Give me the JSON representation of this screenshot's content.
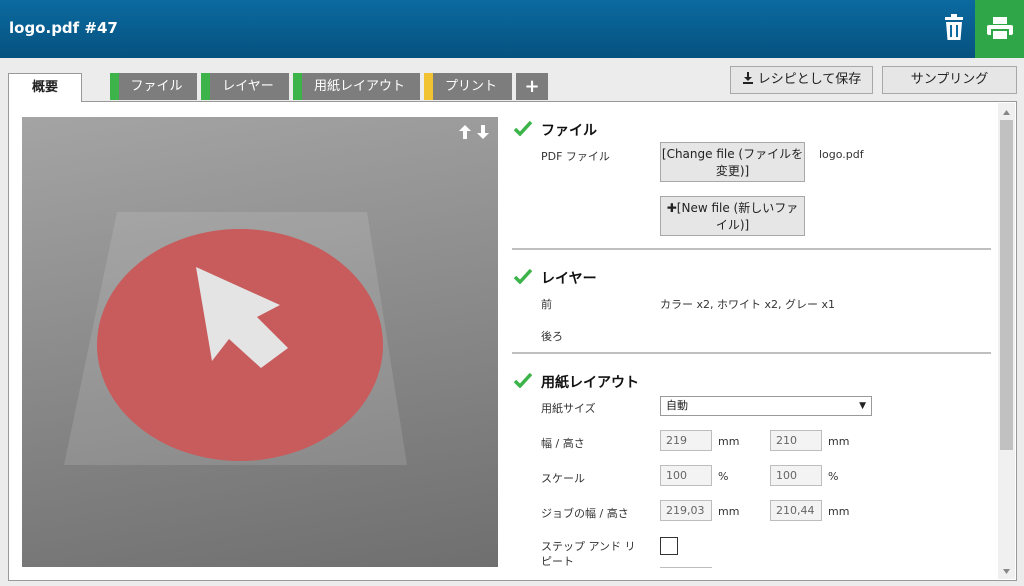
{
  "header": {
    "title": "logo.pdf #47",
    "trash_icon": "trash-icon",
    "print_icon": "printer-icon"
  },
  "tabs": [
    {
      "label": "概要",
      "stripe": ""
    },
    {
      "label": "ファイル",
      "stripe": "#3cb44a"
    },
    {
      "label": "レイヤー",
      "stripe": "#3cb44a"
    },
    {
      "label": "用紙レイアウト",
      "stripe": "#3cb44a"
    },
    {
      "label": "プリント",
      "stripe": "#f1c232"
    },
    {
      "label": "+",
      "stripe": ""
    }
  ],
  "actions": {
    "save_recipe": "レシピとして保存",
    "sampling": "サンプリング"
  },
  "file": {
    "title": "ファイル",
    "pdf_label": "PDF ファイル",
    "change_button": "[Change file (ファイルを変更)]",
    "new_button": "[New file (新しいファイル)]",
    "filename": "logo.pdf"
  },
  "layer": {
    "title": "レイヤー",
    "front_label": "前",
    "front_value": "カラー x2, ホワイト x2, グレー x1",
    "back_label": "後ろ"
  },
  "paper": {
    "title": "用紙レイアウト",
    "size_label": "用紙サイズ",
    "size_value": "自動",
    "wh_label": "幅 / 高さ",
    "width": "219",
    "height": "210",
    "unit_mm": "mm",
    "scale_label": "スケール",
    "scale_x": "100",
    "scale_y": "100",
    "unit_pct": "%",
    "job_label": "ジョブの幅 / 高さ",
    "job_width": "219,03",
    "job_height": "210,44",
    "step_repeat_label": "ステップ アンド リピート"
  },
  "colors": {
    "header": "#06527f",
    "print": "#2fa748",
    "ok": "#3cb44a",
    "warn": "#f1c232",
    "logo_red": "#c85b5c"
  }
}
